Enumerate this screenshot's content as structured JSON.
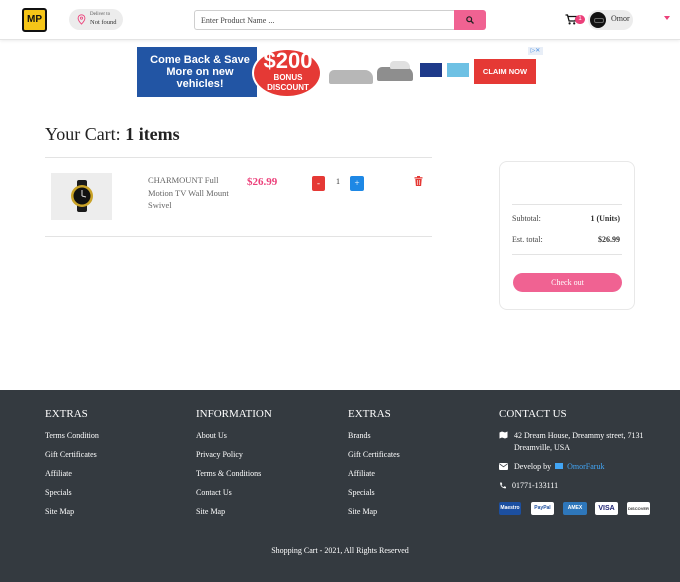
{
  "header": {
    "logo_text": "MP",
    "deliver_label": "Deliver to",
    "deliver_value": "Not found",
    "search_placeholder": "Enter Product Name ...",
    "cart_count": "1",
    "user_name": "Omor",
    "accent_color": "#f06292"
  },
  "ad": {
    "headline": "Come Back & Save More on new vehicles!",
    "amount": "$200",
    "bonus": "BONUS DISCOUNT",
    "cta": "CLAIM NOW",
    "close": "▷✕"
  },
  "cart": {
    "title_prefix": "Your Cart:",
    "title_count": "1 items",
    "items": [
      {
        "name": "CHARMOUNT Full Motion TV Wall Mount Swivel",
        "price": "$26.99",
        "quantity": "1",
        "minus_label": "-",
        "plus_label": "+"
      }
    ]
  },
  "summary": {
    "subtotal_label": "Subtotal:",
    "subtotal_value": "1 (Units)",
    "total_label": "Est. total:",
    "total_value": "$26.99",
    "checkout_label": "Check out"
  },
  "footer": {
    "columns": [
      {
        "title": "EXTRAS",
        "links": [
          "Terms Condition",
          "Gift Certificates",
          "Affiliate",
          "Specials",
          "Site Map"
        ]
      },
      {
        "title": "INFORMATION",
        "links": [
          "About Us",
          "Privacy Policy",
          "Terms & Conditions",
          "Contact Us",
          "Site Map"
        ]
      },
      {
        "title": "EXTRAS",
        "links": [
          "Brands",
          "Gift Certificates",
          "Affiliate",
          "Specials",
          "Site Map"
        ]
      }
    ],
    "contact": {
      "title": "CONTACT US",
      "address": "42 Dream House, Dreammy street, 7131 Dreamville, USA",
      "develop_prefix": "Develop by",
      "developer": "OmorFaruk",
      "phone": "01771-133111"
    },
    "payments": [
      "Maestro",
      "PayPal",
      "AMEX",
      "VISA",
      "DISCOVER"
    ],
    "copyright": "Shopping Cart - 2021, All Rights Reserved"
  }
}
